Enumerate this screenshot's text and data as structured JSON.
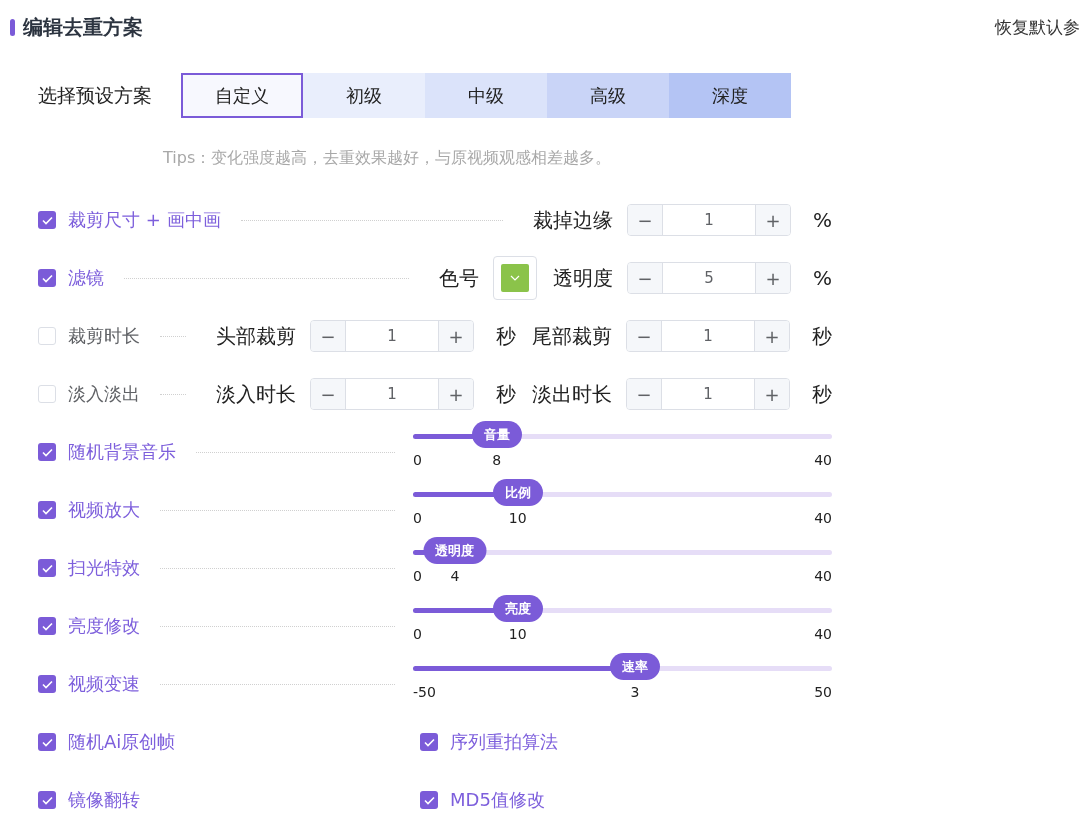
{
  "header": {
    "title": "编辑去重方案",
    "reset_link": "恢复默认参"
  },
  "preset": {
    "label": "选择预设方案",
    "tabs": [
      {
        "label": "自定义",
        "selected": true,
        "color": "#f7f8fe"
      },
      {
        "label": "初级",
        "selected": false,
        "color": "#e9eefc"
      },
      {
        "label": "中级",
        "selected": false,
        "color": "#dbe3fa"
      },
      {
        "label": "高级",
        "selected": false,
        "color": "#c9d4f7"
      },
      {
        "label": "深度",
        "selected": false,
        "color": "#b4c4f4"
      }
    ]
  },
  "tips": "Tips：变化强度越高，去重效果越好，与原视频观感相差越多。",
  "rows": [
    {
      "kind": "controls",
      "label": "裁剪尺寸 + 画中画",
      "checked": true,
      "controls": [
        {
          "kind": "stepper",
          "label": "裁掉边缘",
          "minus": "−",
          "value": "1",
          "plus": "+",
          "unit": "%"
        }
      ]
    },
    {
      "kind": "controls",
      "label": "滤镜",
      "checked": true,
      "controls": [
        {
          "kind": "swatch",
          "label": "色号",
          "color": "#8bc34a"
        },
        {
          "kind": "stepper",
          "label": "透明度",
          "minus": "−",
          "value": "5",
          "plus": "+",
          "unit": "%"
        }
      ]
    },
    {
      "kind": "controls",
      "label": "裁剪时长",
      "checked": false,
      "controls": [
        {
          "kind": "stepper",
          "label": "头部裁剪",
          "minus": "−",
          "value": "1",
          "plus": "+",
          "unit": "秒"
        },
        {
          "kind": "stepper",
          "label": "尾部裁剪",
          "minus": "−",
          "value": "1",
          "plus": "+",
          "unit": "秒"
        }
      ]
    },
    {
      "kind": "controls",
      "label": "淡入淡出",
      "checked": false,
      "controls": [
        {
          "kind": "stepper",
          "label": "淡入时长",
          "minus": "−",
          "value": "1",
          "plus": "+",
          "unit": "秒"
        },
        {
          "kind": "stepper",
          "label": "淡出时长",
          "minus": "−",
          "value": "1",
          "plus": "+",
          "unit": "秒"
        }
      ]
    },
    {
      "kind": "slider",
      "label": "随机背景音乐",
      "checked": true,
      "thumb": "音量",
      "min": "0",
      "value": "8",
      "max": "40",
      "level": 0.2
    },
    {
      "kind": "slider",
      "label": "视频放大",
      "checked": true,
      "thumb": "比例",
      "min": "0",
      "value": "10",
      "max": "40",
      "level": 0.25
    },
    {
      "kind": "slider",
      "label": "扫光特效",
      "checked": true,
      "thumb": "透明度",
      "min": "0",
      "value": "4",
      "max": "40",
      "level": 0.1
    },
    {
      "kind": "slider",
      "label": "亮度修改",
      "checked": true,
      "thumb": "亮度",
      "min": "0",
      "value": "10",
      "max": "40",
      "level": 0.25
    },
    {
      "kind": "slider",
      "label": "视频变速",
      "checked": true,
      "thumb": "速率",
      "min": "-50",
      "value": "3",
      "max": "50",
      "level": 0.53
    },
    {
      "kind": "pair",
      "items": [
        {
          "label": "随机Ai原创帧",
          "checked": true
        },
        {
          "label": "序列重拍算法",
          "checked": true
        }
      ]
    },
    {
      "kind": "pair",
      "items": [
        {
          "label": "镜像翻转",
          "checked": true
        },
        {
          "label": "MD5值修改",
          "checked": true
        }
      ]
    }
  ]
}
